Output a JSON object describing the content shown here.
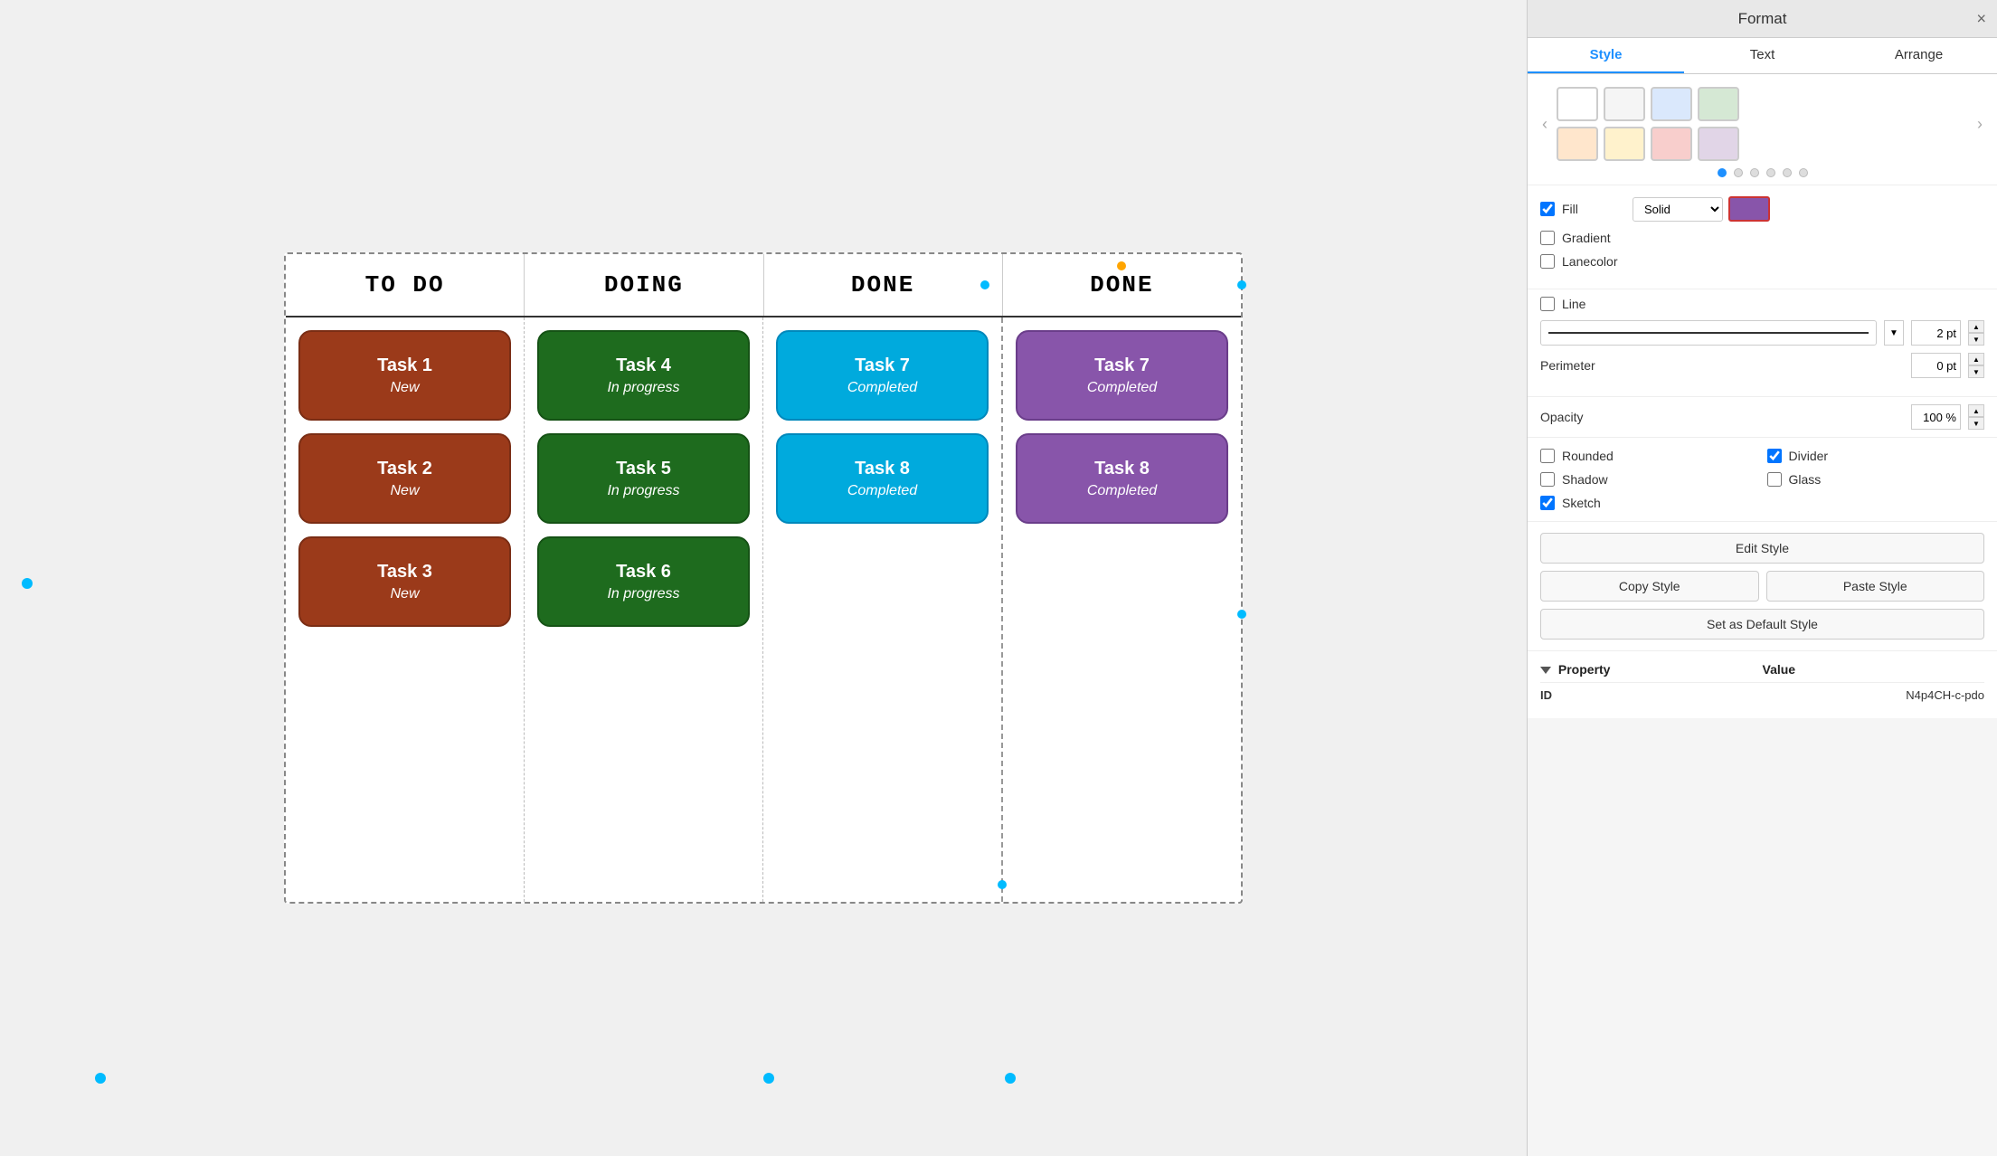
{
  "format_panel": {
    "title": "Format",
    "close_label": "×",
    "tabs": [
      {
        "label": "Style",
        "active": true
      },
      {
        "label": "Text",
        "active": false
      },
      {
        "label": "Arrange",
        "active": false
      }
    ],
    "color_swatches": [
      {
        "row": 1,
        "colors": [
          "#ffffff",
          "#f5f5f5",
          "#dae8fc",
          "#d5e8d4"
        ]
      },
      {
        "row": 2,
        "colors": [
          "#ffe6cc",
          "#fff2cc",
          "#f8cecc",
          "#e1d5e7"
        ]
      }
    ],
    "fill": {
      "checkbox_checked": true,
      "label": "Fill",
      "type": "Solid",
      "color": "#8855AA"
    },
    "gradient_label": "Gradient",
    "lanecolor_label": "Lanecolor",
    "line": {
      "label": "Line",
      "pt_value": "2 pt",
      "perimeter_label": "Perimeter",
      "perimeter_value": "0 pt"
    },
    "opacity": {
      "label": "Opacity",
      "value": "100 %"
    },
    "checkboxes": {
      "rounded": {
        "label": "Rounded",
        "checked": false
      },
      "divider": {
        "label": "Divider",
        "checked": true
      },
      "shadow": {
        "label": "Shadow",
        "checked": false
      },
      "glass": {
        "label": "Glass",
        "checked": false
      },
      "sketch": {
        "label": "Sketch",
        "checked": true
      }
    },
    "buttons": {
      "edit_style": "Edit Style",
      "copy_style": "Copy Style",
      "paste_style": "Paste Style",
      "set_default": "Set as Default Style"
    },
    "property_table": {
      "col1": "Property",
      "col2": "Value",
      "rows": [
        {
          "key": "ID",
          "value": "N4p4CH-c-pdo"
        }
      ]
    }
  },
  "kanban": {
    "columns": [
      {
        "header": "TO DO"
      },
      {
        "header": "DOING"
      },
      {
        "header": "DONE"
      },
      {
        "header": "DONE"
      }
    ],
    "cards": {
      "todo": [
        {
          "title": "Task 1",
          "subtitle": "New"
        },
        {
          "title": "Task 2",
          "subtitle": "New"
        },
        {
          "title": "Task 3",
          "subtitle": "New"
        }
      ],
      "doing": [
        {
          "title": "Task 4",
          "subtitle": "In progress"
        },
        {
          "title": "Task 5",
          "subtitle": "In progress"
        },
        {
          "title": "Task 6",
          "subtitle": "In progress"
        }
      ],
      "done1": [
        {
          "title": "Task 7",
          "subtitle": "Completed"
        },
        {
          "title": "Task 8",
          "subtitle": "Completed"
        }
      ],
      "done2": [
        {
          "title": "Task 7",
          "subtitle": "Completed"
        },
        {
          "title": "Task 8",
          "subtitle": "Completed"
        }
      ]
    }
  }
}
